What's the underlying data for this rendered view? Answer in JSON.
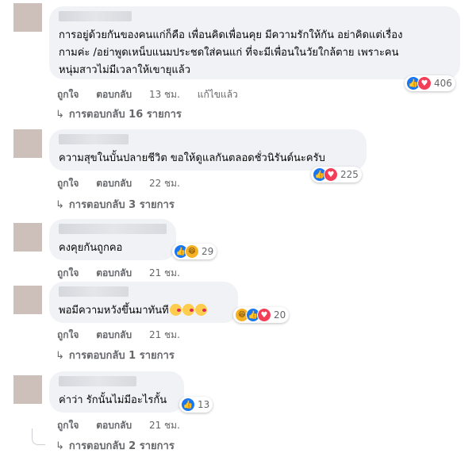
{
  "comments": [
    {
      "text_lines": [
        "การอยู่ด้วยกันของคนแก่ก็คือ เพื่อนคิดเพื่อนคุย มีความรักให้กัน อย่าคิดแต่เรื่อง",
        "กามค่ะ /อย่าพูดเหน็บแนมประชดใส่คนแก่ ที่จะมีเพื่อนในวัยใกล้ตาย เพราะคน",
        "หนุ่มสาวไม่มีเวลาให้เขายุแล้ว"
      ],
      "reactions": [
        "like",
        "love"
      ],
      "reaction_count": "406",
      "like_label": "ถูกใจ",
      "reply_label": "ตอบกลับ",
      "time": "13 ชม.",
      "edited": "แก้ไขแล้ว",
      "replies": "การตอบกลับ 16 รายการ"
    },
    {
      "text_lines": [
        "ความสุขในบั้นปลายชีวิต ขอให้ดูแลกันตลอดชั่วนิรันด์นะครับ"
      ],
      "reactions": [
        "like",
        "love"
      ],
      "reaction_count": "225",
      "like_label": "ถูกใจ",
      "reply_label": "ตอบกลับ",
      "time": "22 ชม.",
      "replies": "การตอบกลับ 3 รายการ"
    },
    {
      "text_lines": [
        "คงคุยกันถูกคอ"
      ],
      "reactions": [
        "like",
        "haha"
      ],
      "reaction_count": "29",
      "like_label": "ถูกใจ",
      "reply_label": "ตอบกลับ",
      "time": "21 ชม."
    },
    {
      "text_lines": [
        "พอมีความหวังขึ้นมาทันที"
      ],
      "emoji_count_inline": 3,
      "reactions": [
        "haha",
        "like",
        "love"
      ],
      "reaction_count": "20",
      "like_label": "ถูกใจ",
      "reply_label": "ตอบกลับ",
      "time": "21 ชม.",
      "replies": "การตอบกลับ 1 รายการ"
    },
    {
      "text_lines": [
        "ค่าว่า รักนั้นไม่มีอะไรกั้น"
      ],
      "reactions": [
        "like"
      ],
      "reaction_count": "13",
      "like_label": "ถูกใจ",
      "reply_label": "ตอบกลับ",
      "time": "21 ชม.",
      "replies": "การตอบกลับ 2 รายการ"
    }
  ],
  "colors": {
    "like": "#1877f2",
    "love": "#f33e58",
    "haha": "#f7b125",
    "bubble": "#f0f2f5",
    "meta": "#65676b"
  }
}
